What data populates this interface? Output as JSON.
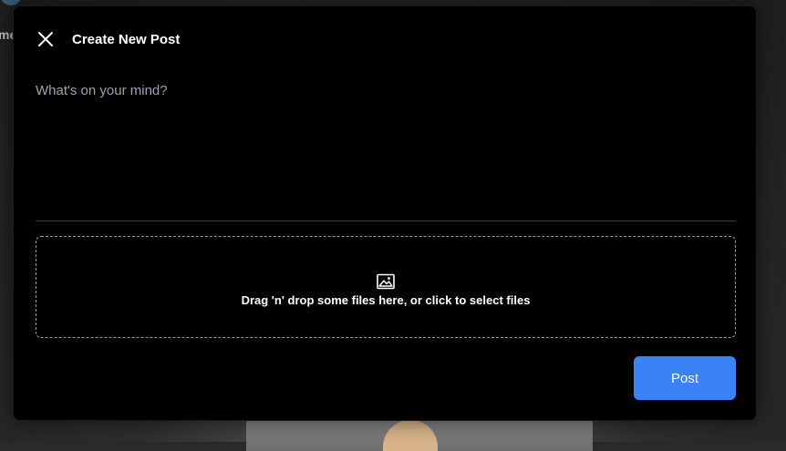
{
  "background": {
    "partial_text": "me"
  },
  "modal": {
    "title": "Create New Post",
    "close_icon": "close-icon",
    "textarea": {
      "placeholder": "What's on your mind?",
      "value": ""
    },
    "dropzone": {
      "icon": "image-icon",
      "text": "Drag 'n' drop some files here, or click to select files"
    },
    "post_button_label": "Post"
  },
  "colors": {
    "modal_background": "#000000",
    "accent": "#3b82f6",
    "placeholder": "#9ca3af"
  }
}
